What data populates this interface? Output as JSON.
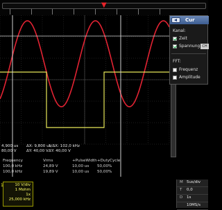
{
  "colors": {
    "background": "#000000",
    "grid": "#3c3c3c",
    "channel1": "#e32333",
    "channel2": "#e8e85a",
    "cursor": "#cfcfcf",
    "panel_header": "#4f72a8"
  },
  "trigger_marker": "▼",
  "measurements": {
    "cursor_readout": {
      "t1": "4,900 us",
      "v1": "80,00 V",
      "dx": "ΔX: 9,800 us",
      "dy": "ΔY: 40,00 V",
      "inv_dx": "1/ΔX: 102,0 kHz",
      "dy2": "ΔY: 40,00 V"
    },
    "table": {
      "headers": [
        "Frequency",
        "Vrms",
        "+PulseWidth",
        "+DutyCycle"
      ],
      "rows": [
        [
          "100,0 kHz",
          "24,89 V",
          "10,00 us",
          "50,00%"
        ],
        [
          "100,0 kHz",
          "19,89 V",
          "10,00 us",
          "50,00%"
        ]
      ]
    }
  },
  "channel_box": {
    "number": "1",
    "lines": [
      "10 V/div",
      "1 Mohm",
      "1x",
      "25,000 kHz"
    ]
  },
  "timebase": {
    "rows": [
      {
        "key": "M",
        "value": "5us/div"
      },
      {
        "key": "T",
        "value": "0,0"
      },
      {
        "key": "D",
        "value": "1s"
      },
      {
        "key": "",
        "value": "10MS/s"
      }
    ]
  },
  "panel": {
    "title": "Cur",
    "kanal_label": "Kanal:",
    "zeit_label": "Zeit",
    "zeit_checked": true,
    "spannung_label": "Spannung",
    "spannung_checked": true,
    "spannung_channel": "CH",
    "fft_label": "FFT:",
    "frequenz_label": "Frequenz",
    "frequenz_checked": false,
    "amplitude_label": "Amplitude",
    "amplitude_checked": false
  }
}
